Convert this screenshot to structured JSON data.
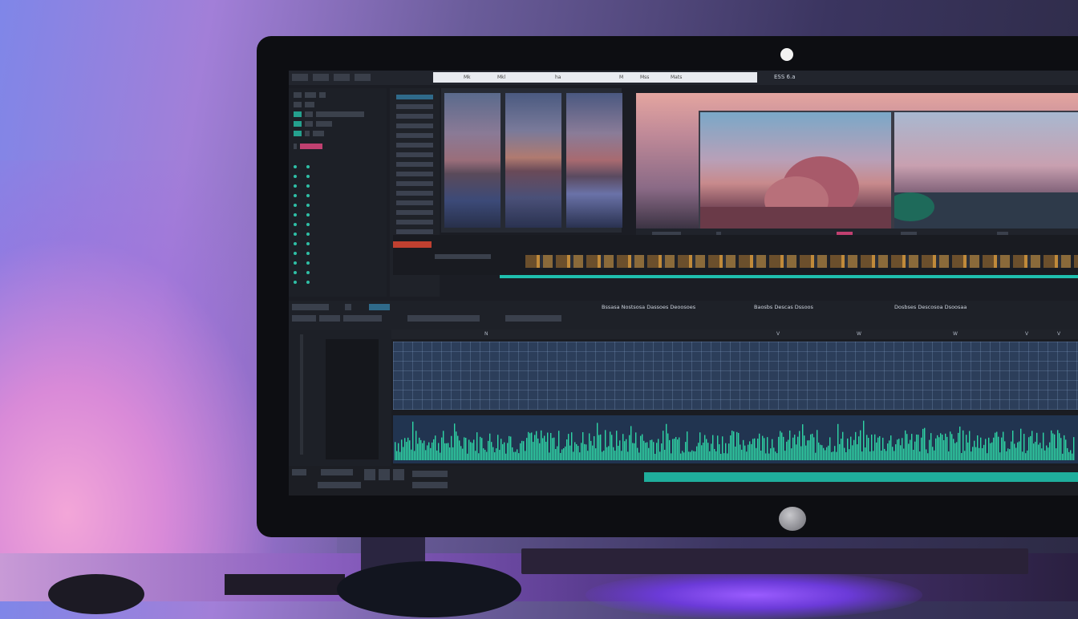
{
  "colors": {
    "accent": "#1fbfae",
    "clip_orange": "#c08a3a",
    "audio_wave": "#2fd6a6",
    "marker_pink": "#c04070"
  },
  "monitor": {
    "camera": "camera",
    "power_button": "power-button"
  },
  "editor": {
    "menu": [
      "",
      "",
      "",
      ""
    ],
    "address_bar": {
      "segments": [
        "Mk",
        "Mkl",
        "ha",
        "M",
        "Mss",
        "Mats"
      ]
    },
    "top_right_label": "ESS 6.a",
    "viewer": {
      "controls": [
        "",
        "",
        "",
        ""
      ]
    },
    "timeline": {
      "playhead_fraction": 0.0
    },
    "readout": {
      "left_text": "Bssasa Nostsosa Dassoes Deoosoes",
      "right_text": "Baosbs Descas Dssoos",
      "far_right_text": "Dosbses Descosoa Dsoosaa"
    },
    "ruler_ticks": [
      "N",
      "",
      "",
      "V",
      "W",
      "W",
      "V",
      "V"
    ],
    "progress_fraction": 0.55
  }
}
